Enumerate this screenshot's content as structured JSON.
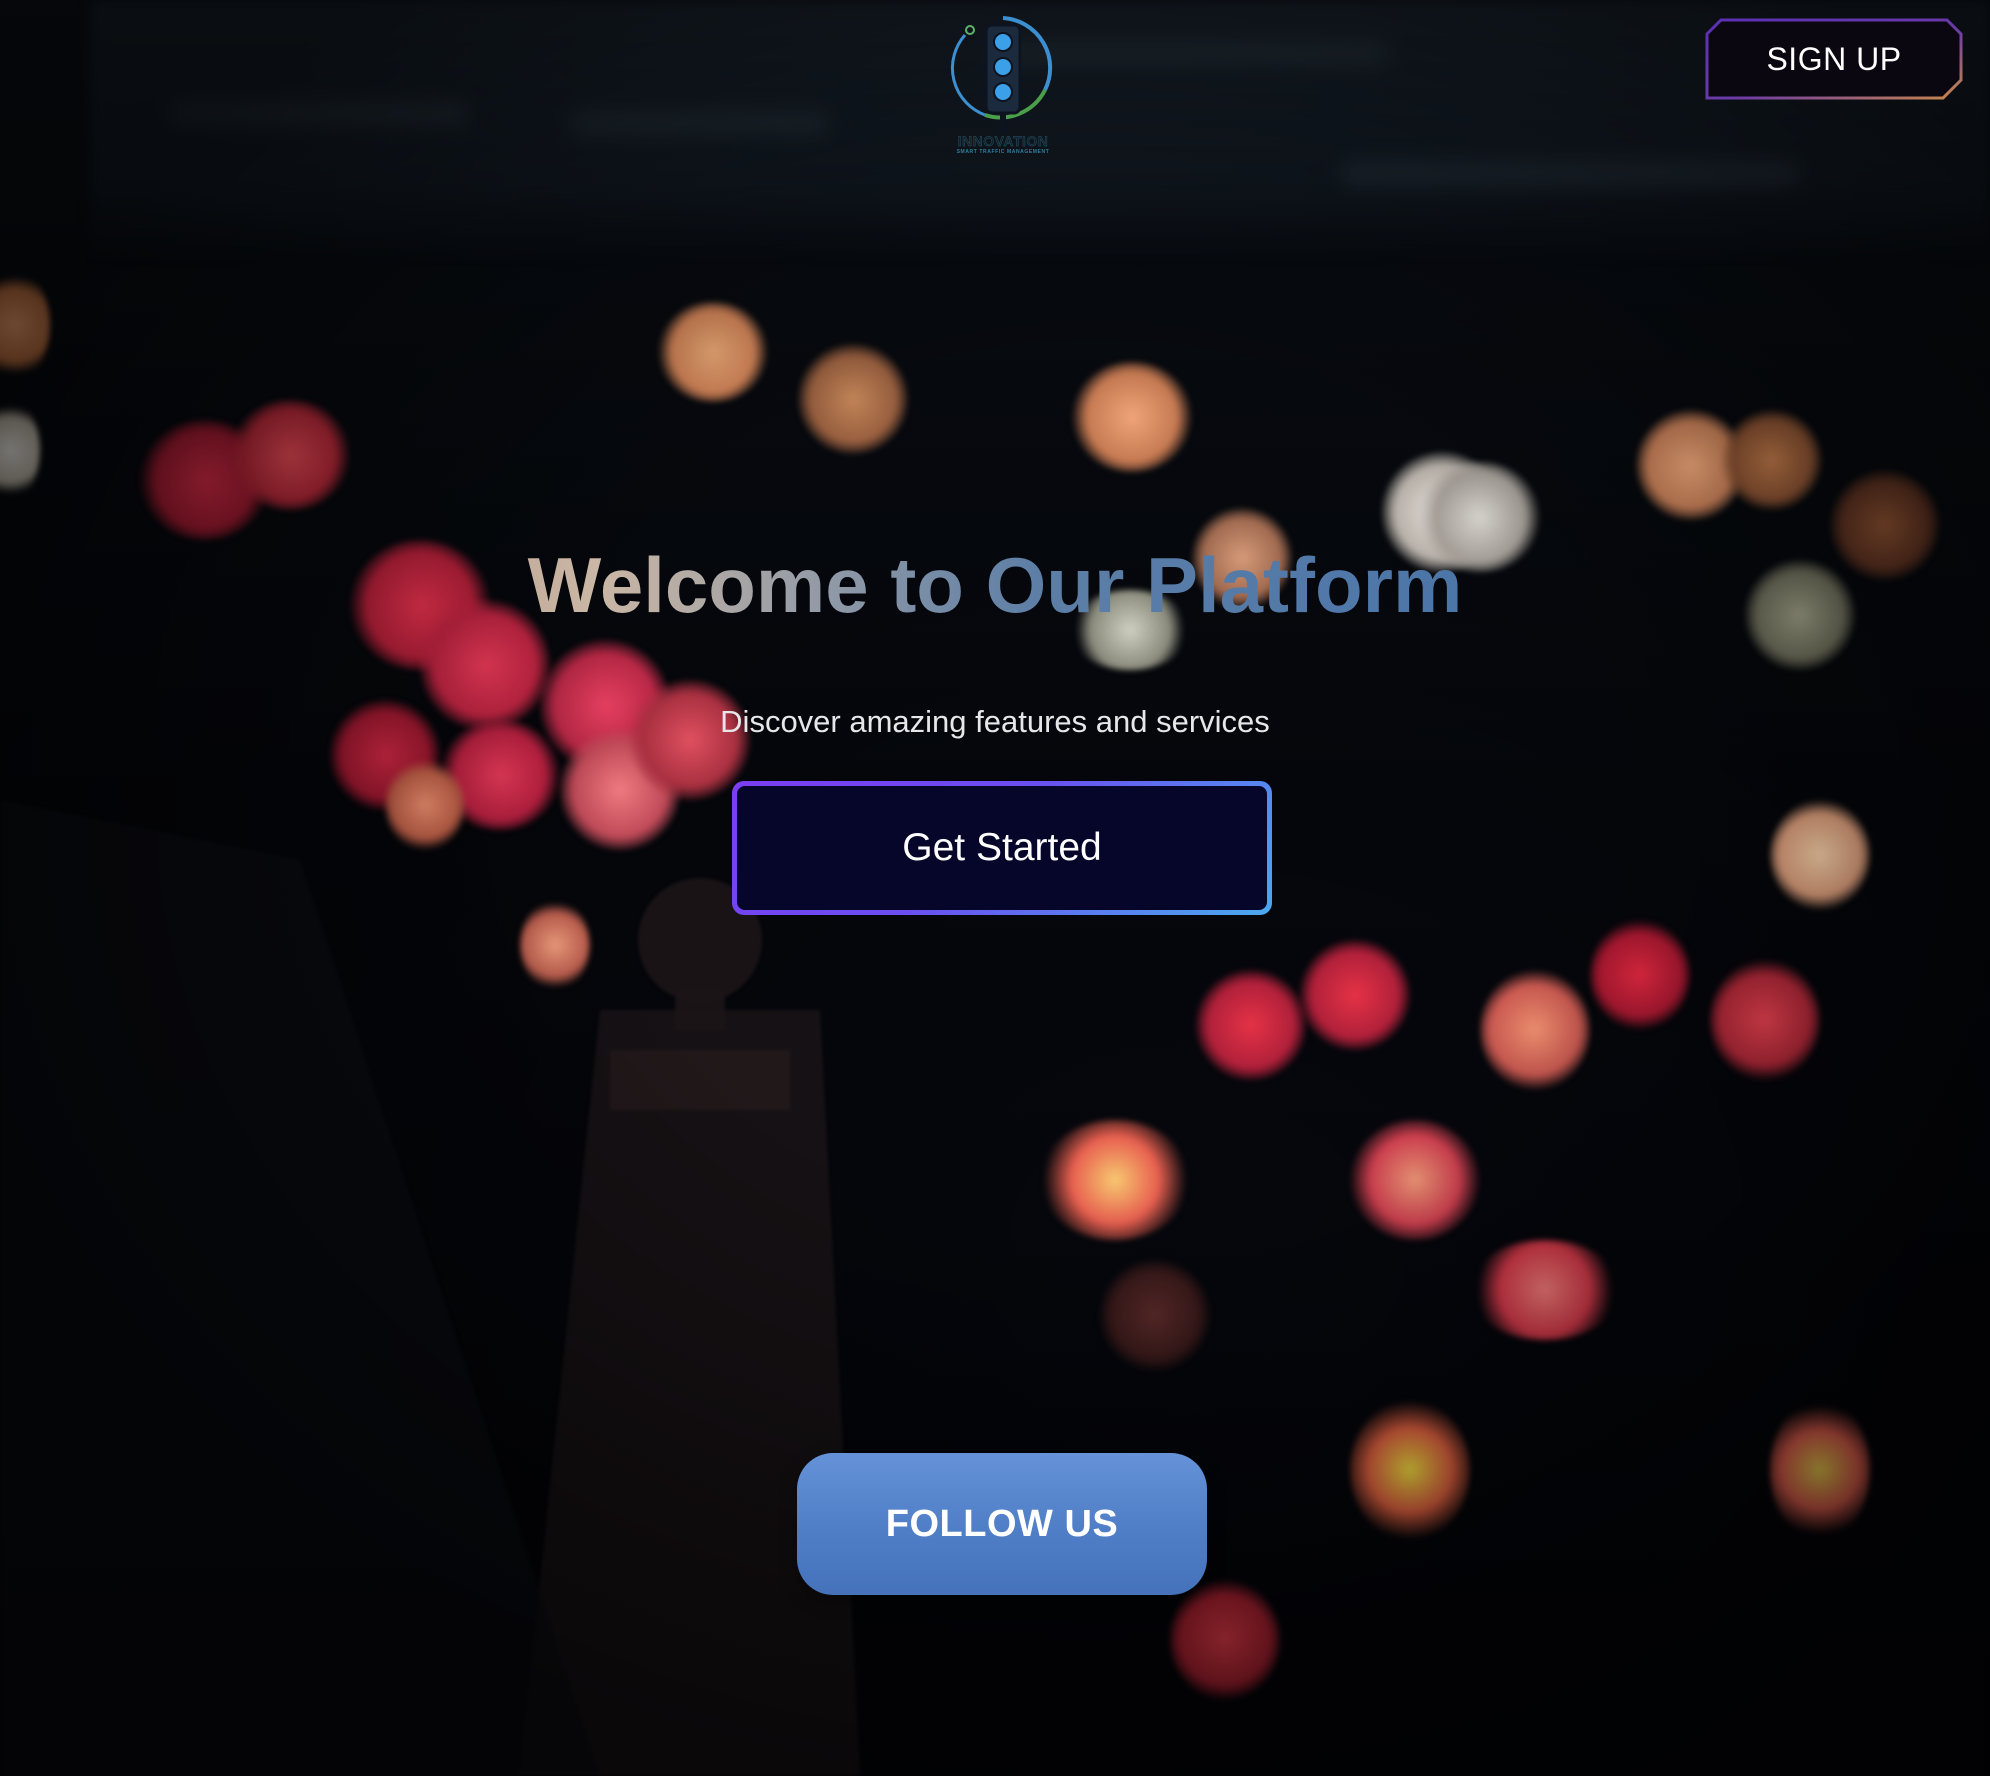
{
  "header": {
    "logo_icon": "traffic-light-icon",
    "logo_title": "INNOVATION",
    "logo_tagline": "SMART TRAFFIC MANAGEMENT",
    "signup_label": "SIGN UP"
  },
  "hero": {
    "title": "Welcome to Our Platform",
    "subtitle": "Discover amazing features and services",
    "cta_label": "Get Started"
  },
  "footer": {
    "follow_label": "FOLLOW US"
  },
  "colors": {
    "cta_border_start": "#7b3df0",
    "cta_border_end": "#4aa9ef",
    "cta_fill": "#050629",
    "follow_fill": "#5a88d0",
    "signup_border_start": "#5b2fb5",
    "signup_border_end": "#c9864a"
  }
}
